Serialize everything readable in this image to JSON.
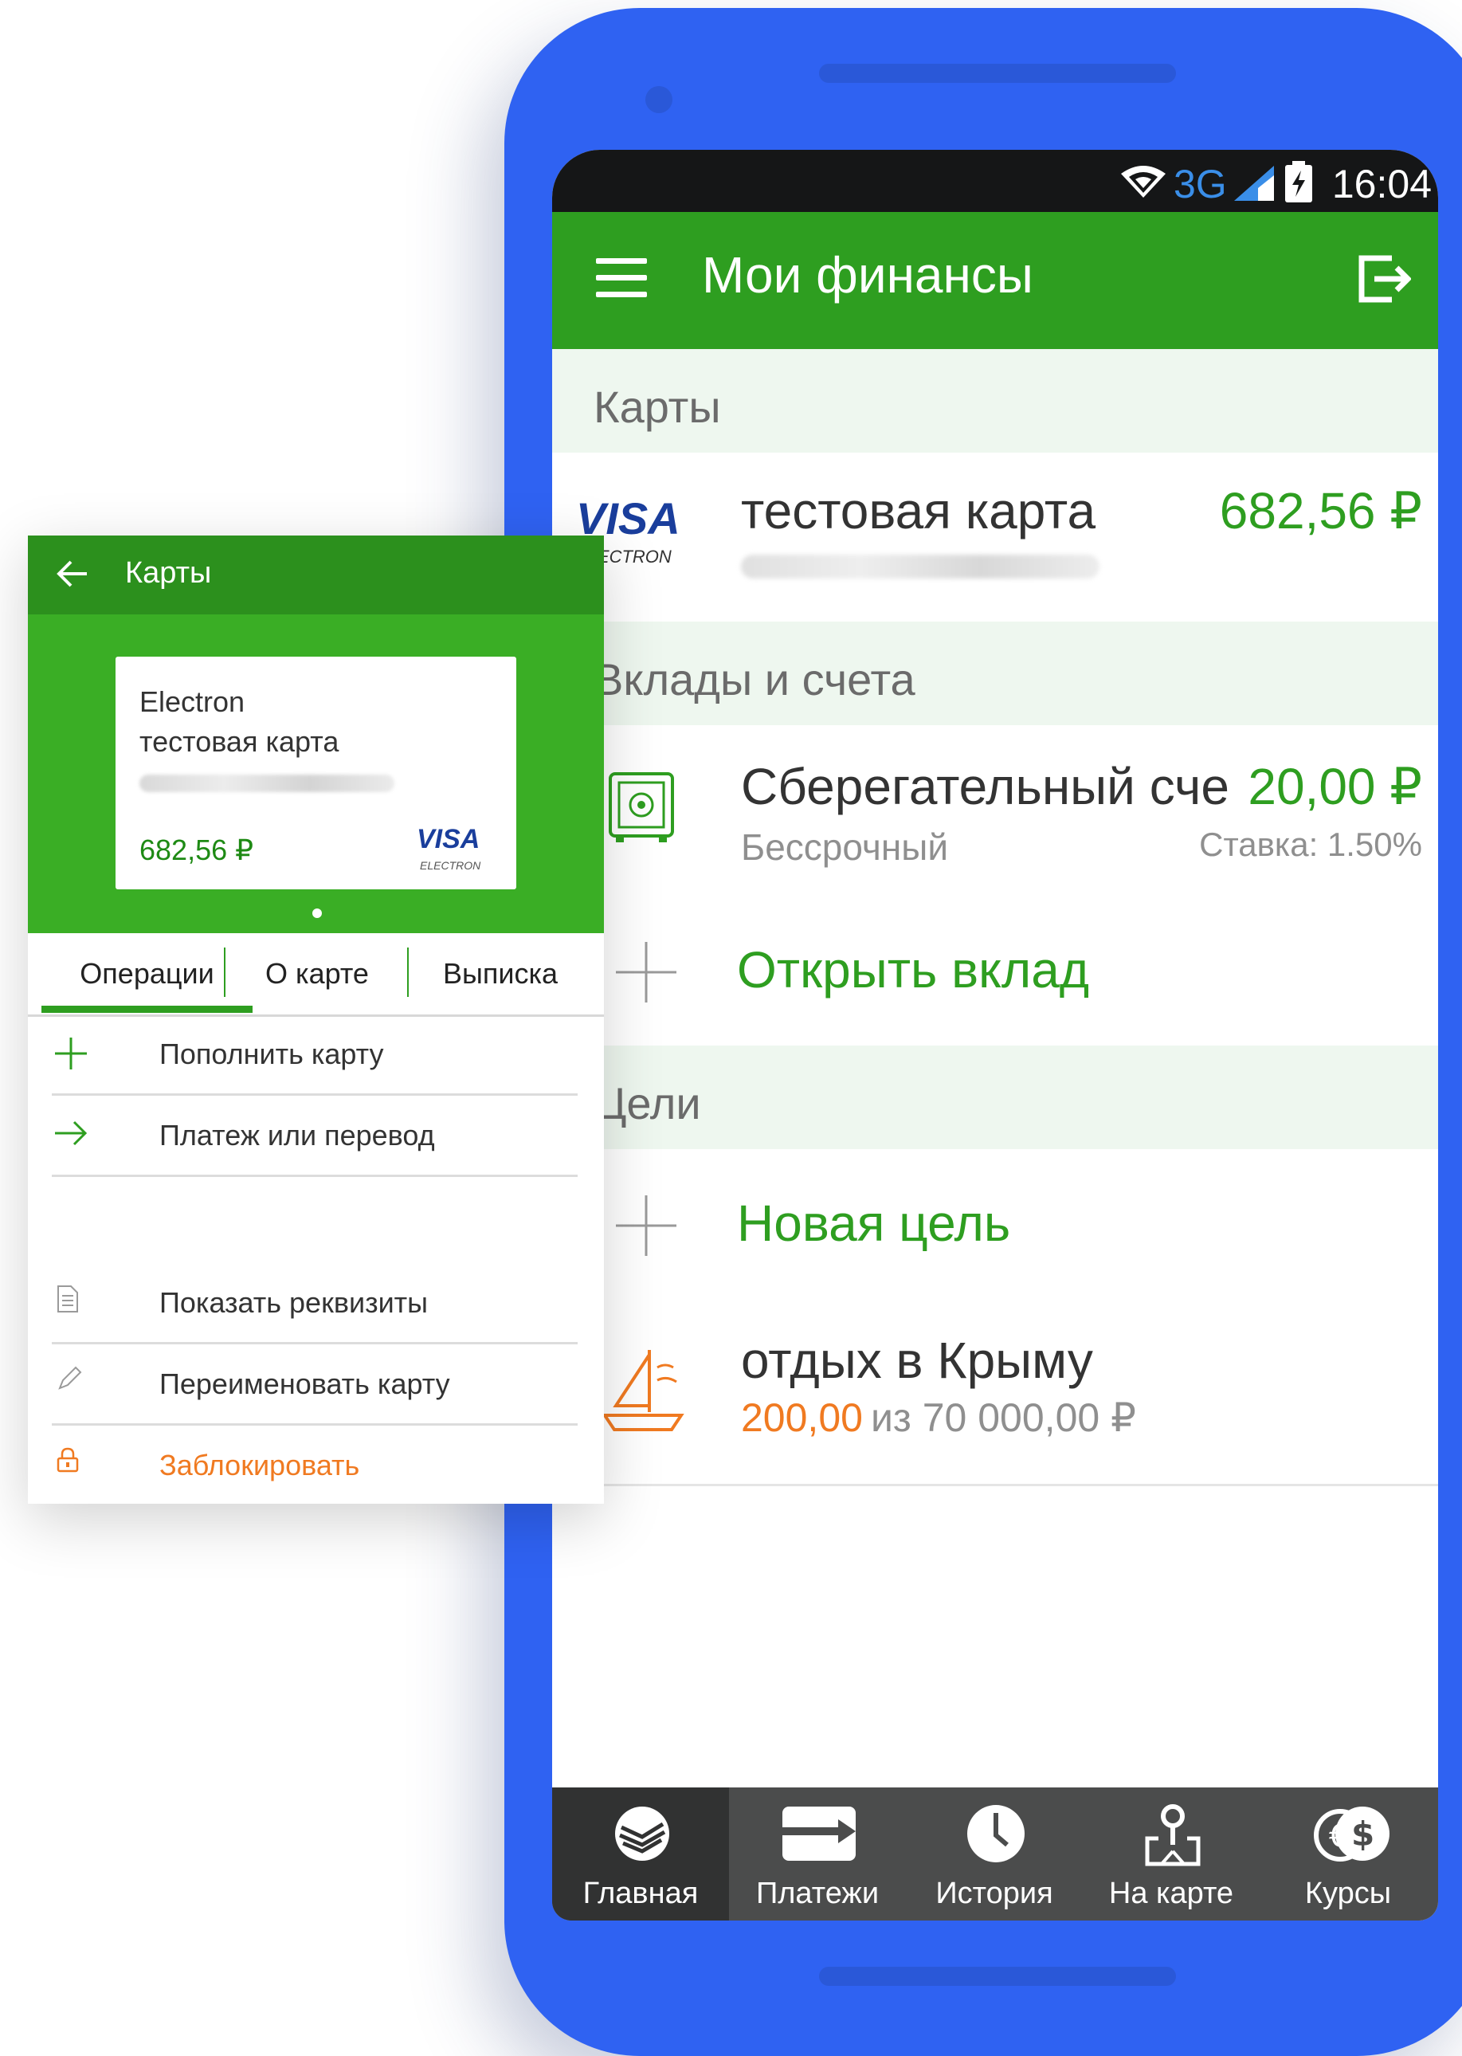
{
  "phone": {
    "status": {
      "network": "3G",
      "time": "16:04"
    },
    "title": "Мои финансы",
    "sections": {
      "cards": "Карты",
      "deposits": "Вклады и счета",
      "goals": "Цели"
    },
    "card_row": {
      "brand": "VISA",
      "brand_sub": "ELECTRON",
      "name": "тестовая карта",
      "amount": "682,56 ₽"
    },
    "savings": {
      "title": "Сберегательный сче",
      "subtitle": "Бессрочный",
      "amount": "20,00 ₽",
      "rate": "Ставка: 1.50%"
    },
    "open_deposit": "Открыть вклад",
    "new_goal": "Новая цель",
    "goal": {
      "title": "отдых в Крыму",
      "saved": "200,00",
      "rest": "из 70 000,00 ₽"
    },
    "nav": [
      {
        "label": "Главная",
        "icon": "bank-logo-icon",
        "active": true
      },
      {
        "label": "Платежи",
        "icon": "payments-icon"
      },
      {
        "label": "История",
        "icon": "clock-icon"
      },
      {
        "label": "На карте",
        "icon": "map-pin-icon"
      },
      {
        "label": "Курсы",
        "icon": "currency-icon"
      }
    ]
  },
  "overlay": {
    "title": "Карты",
    "card": {
      "line1": "Electron",
      "line2": "тестовая карта",
      "amount": "682,56 ₽",
      "brand": "VISA",
      "brand_sub": "ELECTRON"
    },
    "tabs": [
      "Операции",
      "О карте",
      "Выписка"
    ],
    "actions": {
      "top_up": "Пополнить карту",
      "transfer": "Платеж или перевод",
      "details": "Показать реквизиты",
      "rename": "Переименовать карту",
      "block": "Заблокировать"
    }
  },
  "colors": {
    "brand_green": "#2e9e20",
    "phone_blue": "#2f62f2",
    "accent_orange": "#f07a21"
  }
}
